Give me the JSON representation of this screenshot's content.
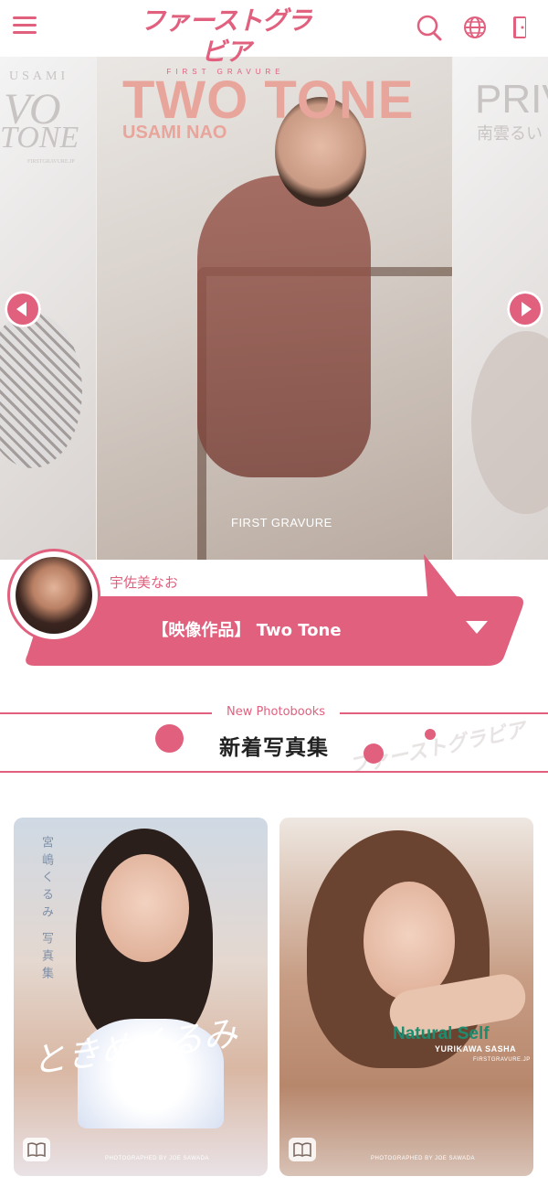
{
  "header": {
    "logo_main": "ファーストグラビア",
    "logo_sub": "FIRST GRAVURE"
  },
  "hero": {
    "main": {
      "title": "TWO TONE",
      "subtitle": "USAMI NAO",
      "brand": "FIRST GRAVURE"
    },
    "left_partial": {
      "line1": "USAMI",
      "line2": "VO",
      "line3": "TONE",
      "small": "FIRSTGRAVURE.JP"
    },
    "right_partial": {
      "line1": "PRIV",
      "line2": "南雲るい"
    }
  },
  "featured": {
    "artist_name": "宇佐美なお",
    "work_title": "【映像作品】 Two Tone"
  },
  "section": {
    "label_en": "New Photobooks",
    "label_jp": "新着写真集",
    "watermark": "ファーストグラビア"
  },
  "cards": [
    {
      "vertical_text": "宮嶋くるみ 写真集",
      "script_title": "ときめくるみ",
      "credit": "PHOTOGRAPHED BY JOE SAWADA"
    },
    {
      "title": "Natural Self",
      "subtitle": "YURIKAWA SASHA",
      "site": "FIRSTGRAVURE.JP",
      "credit": "PHOTOGRAPHED BY JOE SAWADA"
    }
  ],
  "colors": {
    "accent": "#e0607e",
    "title_salmon": "#e8a59b",
    "natural_green": "#1e8c6e"
  },
  "icons": [
    "menu-icon",
    "search-icon",
    "globe-icon",
    "login-door-icon",
    "chevron-left-icon",
    "chevron-right-icon",
    "chevron-down-icon",
    "photobook-icon"
  ]
}
